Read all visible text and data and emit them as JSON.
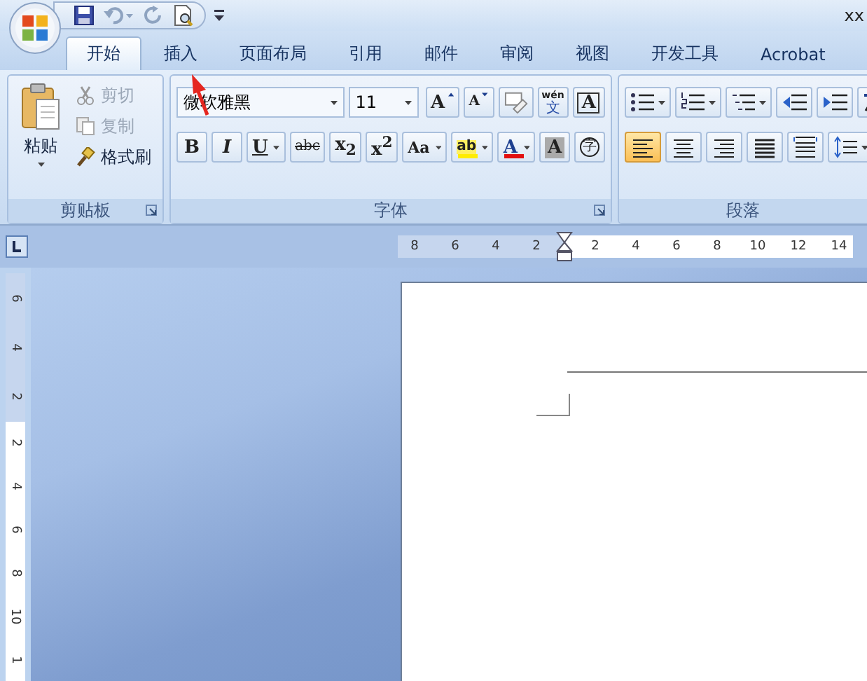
{
  "title_bar": {
    "title": "xx"
  },
  "tabs": [
    {
      "label": "开始",
      "selected": true
    },
    {
      "label": "插入",
      "selected": false
    },
    {
      "label": "页面布局",
      "selected": false
    },
    {
      "label": "引用",
      "selected": false
    },
    {
      "label": "邮件",
      "selected": false
    },
    {
      "label": "审阅",
      "selected": false
    },
    {
      "label": "视图",
      "selected": false
    },
    {
      "label": "开发工具",
      "selected": false
    },
    {
      "label": "Acrobat",
      "selected": false
    }
  ],
  "clipboard": {
    "label": "剪贴板",
    "paste": "粘贴",
    "items": [
      {
        "kind": "cut",
        "label": "剪切",
        "disabled": true
      },
      {
        "kind": "copy",
        "label": "复制",
        "disabled": true
      },
      {
        "kind": "painter",
        "label": "格式刷",
        "disabled": false
      }
    ]
  },
  "font": {
    "label": "字体",
    "font_name": "微软雅黑",
    "font_size": "11",
    "row1_buttons": [
      {
        "kind": "grow",
        "text": "A"
      },
      {
        "kind": "shrink",
        "text": "A"
      },
      {
        "kind": "clear"
      },
      {
        "kind": "phonetic",
        "text": "wén",
        "sub": "文"
      },
      {
        "kind": "border",
        "text": "A"
      }
    ],
    "row2_buttons": [
      {
        "kind": "bold",
        "text": "B"
      },
      {
        "kind": "italic",
        "text": "I"
      },
      {
        "kind": "underline",
        "text": "U",
        "dropdown": true
      },
      {
        "kind": "strike",
        "text": "abc"
      },
      {
        "kind": "subscript",
        "text": "x$_{2}$"
      },
      {
        "kind": "superscript",
        "text": "x$^{2}$"
      },
      {
        "kind": "case",
        "text": "Aa",
        "dropdown": true
      },
      {
        "kind": "highlight",
        "text": "ab",
        "dropdown": true
      },
      {
        "kind": "color",
        "text": "A",
        "dropdown": true
      },
      {
        "kind": "shading",
        "text": "A"
      },
      {
        "kind": "enclose",
        "text": "字"
      }
    ]
  },
  "paragraph": {
    "label": "段落",
    "alignment": [
      {
        "kind": "left",
        "selected": true
      },
      {
        "kind": "center",
        "selected": false
      },
      {
        "kind": "right",
        "selected": false
      },
      {
        "kind": "justify",
        "selected": false
      },
      {
        "kind": "distributed",
        "selected": false
      }
    ]
  },
  "horizontal_ruler": {
    "left_numbers": [
      "8",
      "6",
      "4",
      "2"
    ],
    "right_numbers": [
      "2",
      "4",
      "6",
      "8",
      "10",
      "12",
      "14"
    ]
  },
  "vertical_ruler": {
    "top_numbers": [
      "6",
      "4",
      "2"
    ],
    "bottom_numbers": [
      "2",
      "4",
      "6",
      "8",
      "10",
      "1"
    ]
  }
}
